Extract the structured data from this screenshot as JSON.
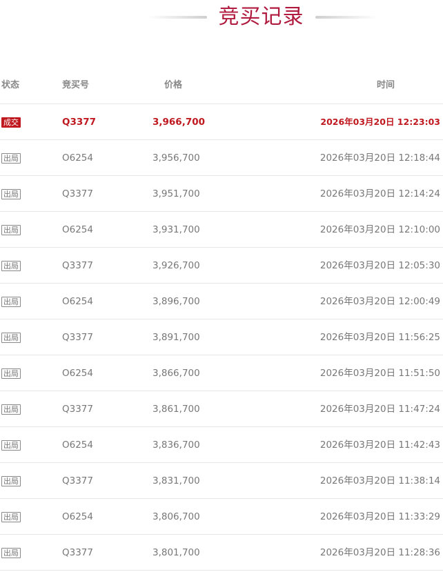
{
  "title": "竞买记录",
  "columns": {
    "status": "状态",
    "bidder": "竞买号",
    "price": "价格",
    "time": "时间"
  },
  "rows": [
    {
      "status": "成交",
      "bidder": "Q3377",
      "price": "3,966,700",
      "time": "2026年03月20日 12:23:03",
      "winner": true
    },
    {
      "status": "出局",
      "bidder": "O6254",
      "price": "3,956,700",
      "time": "2026年03月20日 12:18:44",
      "winner": false
    },
    {
      "status": "出局",
      "bidder": "Q3377",
      "price": "3,951,700",
      "time": "2026年03月20日 12:14:24",
      "winner": false
    },
    {
      "status": "出局",
      "bidder": "O6254",
      "price": "3,931,700",
      "time": "2026年03月20日 12:10:00",
      "winner": false
    },
    {
      "status": "出局",
      "bidder": "Q3377",
      "price": "3,926,700",
      "time": "2026年03月20日 12:05:30",
      "winner": false
    },
    {
      "status": "出局",
      "bidder": "O6254",
      "price": "3,896,700",
      "time": "2026年03月20日 12:00:49",
      "winner": false
    },
    {
      "status": "出局",
      "bidder": "Q3377",
      "price": "3,891,700",
      "time": "2026年03月20日 11:56:25",
      "winner": false
    },
    {
      "status": "出局",
      "bidder": "O6254",
      "price": "3,866,700",
      "time": "2026年03月20日 11:51:50",
      "winner": false
    },
    {
      "status": "出局",
      "bidder": "Q3377",
      "price": "3,861,700",
      "time": "2026年03月20日 11:47:24",
      "winner": false
    },
    {
      "status": "出局",
      "bidder": "O6254",
      "price": "3,836,700",
      "time": "2026年03月20日 11:42:43",
      "winner": false
    },
    {
      "status": "出局",
      "bidder": "Q3377",
      "price": "3,831,700",
      "time": "2026年03月20日 11:38:14",
      "winner": false
    },
    {
      "status": "出局",
      "bidder": "O6254",
      "price": "3,806,700",
      "time": "2026年03月20日 11:33:29",
      "winner": false
    },
    {
      "status": "出局",
      "bidder": "Q3377",
      "price": "3,801,700",
      "time": "2026年03月20日 11:28:36",
      "winner": false
    }
  ],
  "colors": {
    "title": "#b01a3e",
    "winner": "#c0181f",
    "text": "#777777"
  }
}
